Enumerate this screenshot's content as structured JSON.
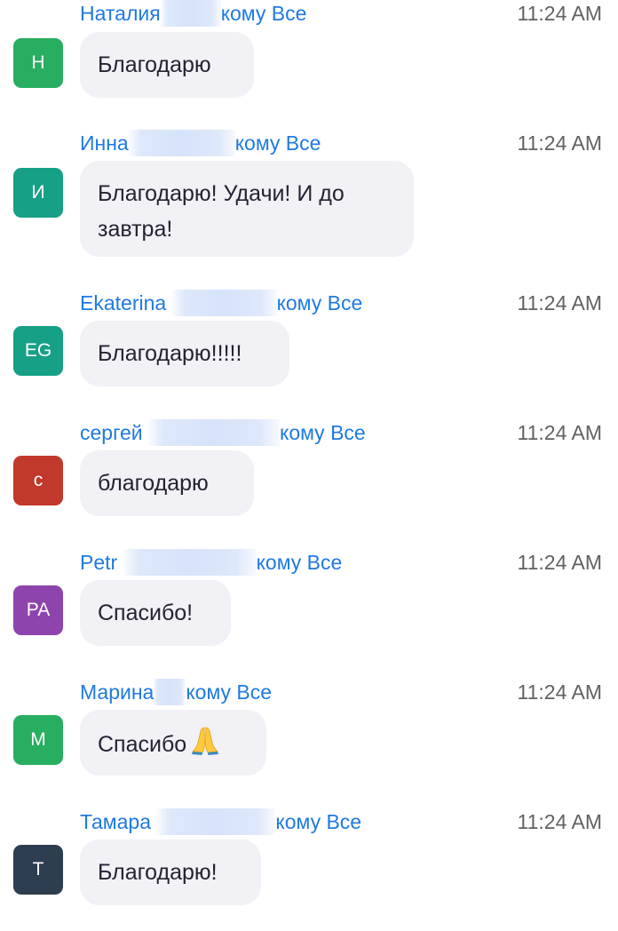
{
  "messages": [
    {
      "sender": "Наталия",
      "to_label": "кому Все",
      "time": "11:24 AM",
      "avatar_letter": "Н",
      "avatar_color": "#27ae60",
      "text": "Благодарю"
    },
    {
      "sender": "Инна",
      "to_label": "кому Все",
      "time": "11:24 AM",
      "avatar_letter": "И",
      "avatar_color": "#16a085",
      "text": "Благодарю! Удачи! И до завтра!"
    },
    {
      "sender": "Ekaterina",
      "to_label": "кому Все",
      "time": "11:24 AM",
      "avatar_letter": "EG",
      "avatar_color": "#16a085",
      "text": "Благодарю!!!!!"
    },
    {
      "sender": "сергей",
      "to_label": "кому Все",
      "time": "11:24 AM",
      "avatar_letter": "с",
      "avatar_color": "#c0392b",
      "text": "благодарю"
    },
    {
      "sender": "Petr",
      "to_label": "кому Все",
      "time": "11:24 AM",
      "avatar_letter": "PA",
      "avatar_color": "#8e44ad",
      "text": "Спасибо!"
    },
    {
      "sender": "Марина",
      "to_label": "кому Все",
      "time": "11:24 AM",
      "avatar_letter": "М",
      "avatar_color": "#27ae60",
      "text": "Спасибо",
      "emoji": "folded-hands-icon"
    },
    {
      "sender": "Тамара",
      "to_label": "кому Все",
      "time": "11:24 AM",
      "avatar_letter": "Т",
      "avatar_color": "#2c3e50",
      "text": "Благодарю!"
    }
  ]
}
